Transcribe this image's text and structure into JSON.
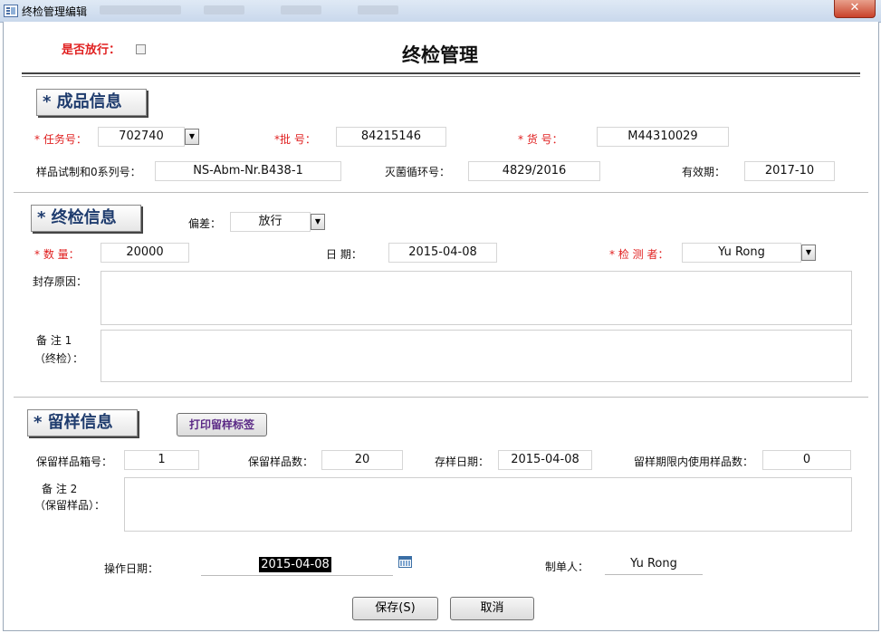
{
  "window": {
    "title": "终检管理编辑",
    "close_glyph": "✕"
  },
  "header": {
    "release_label": "是否放行：",
    "page_title": "终检管理"
  },
  "product": {
    "section_title": "* 成品信息",
    "task_label": "* 任务号：",
    "task_value": "702740",
    "batch_label": "*批    号：",
    "batch_value": "84215146",
    "goods_label": "* 货      号：",
    "goods_value": "M44310029",
    "sample_label": "样品试制和0系列号：",
    "sample_value": "NS-Abm-Nr.B438-1",
    "steril_label": "灭菌循环号：",
    "steril_value": "4829/2016",
    "expiry_label": "有效期：",
    "expiry_value": "2017-10"
  },
  "final": {
    "section_title": "* 终检信息",
    "deviation_label": "偏差：",
    "deviation_value": "放行",
    "qty_label": "* 数    量：",
    "qty_value": "20000",
    "date_label": "日     期：",
    "date_value": "2015-04-08",
    "inspector_label": "* 检  测  者：",
    "inspector_value": "Yu Rong",
    "seal_reason_label": "封存原因：",
    "note1_label_a": "备   注 1",
    "note1_label_b": "（终检）："
  },
  "retain": {
    "section_title": "* 留样信息",
    "print_button": "打印留样标签",
    "box_label": "保留样品箱号：",
    "box_value": "1",
    "count_label": "保留样品数：",
    "count_value": "20",
    "store_date_label": "存样日期：",
    "store_date_value": "2015-04-08",
    "used_label": "留样期限内使用样品数：",
    "used_value": "0",
    "note2_label_a": "备   注 2",
    "note2_label_b": "（保留样品）："
  },
  "footer": {
    "op_date_label": "操作日期：",
    "op_date_value": "2015-04-08",
    "creator_label": "制单人：",
    "creator_value": "Yu Rong",
    "save_button": "保存(S)",
    "cancel_button": "取消"
  },
  "colors": {
    "required": "#e02020",
    "section_text": "#1f3c6e",
    "print_text": "#5b2a86"
  },
  "icons": [
    "app-icon",
    "close-icon",
    "dropdown-arrow-icon",
    "calendar-icon",
    "checkbox-icon"
  ]
}
